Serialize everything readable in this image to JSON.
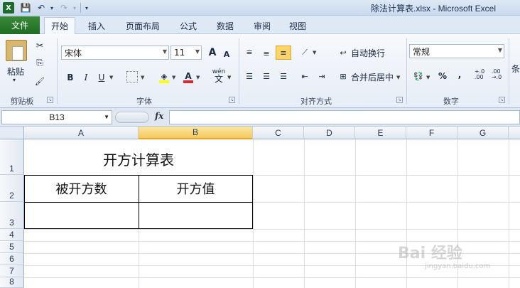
{
  "window": {
    "title": "除法计算表.xlsx  -  Microsoft Excel",
    "app_icon": "X"
  },
  "quick_access": {
    "save_icon": "💾",
    "undo_icon": "↶",
    "redo_icon": "↷",
    "drop": "▾"
  },
  "tabs": {
    "file": "文件",
    "items": [
      "开始",
      "插入",
      "页面布局",
      "公式",
      "数据",
      "审阅",
      "视图"
    ],
    "active": "开始"
  },
  "ribbon": {
    "clipboard": {
      "label": "剪贴板",
      "paste": "粘贴",
      "cut_glyph": "✂",
      "copy_glyph": "⎘",
      "brush_glyph": "🖌"
    },
    "font": {
      "label": "字体",
      "font_name": "宋体",
      "font_size": "11",
      "grow": "A",
      "shrink": "A",
      "bold": "B",
      "italic": "I",
      "underline": "U",
      "phonetic": "wén",
      "phonetic_char": "文"
    },
    "alignment": {
      "label": "对齐方式",
      "wrap": "自动换行",
      "merge": "合并后居中"
    },
    "number": {
      "label": "数字",
      "format": "常规",
      "percent": "%",
      "comma": ",",
      "inc_decimal": "+.0\n.00",
      "dec_decimal": ".00\n→.0"
    },
    "styles": {
      "partial_label": "条"
    }
  },
  "formula_bar": {
    "name_box": "B13",
    "fx": "fx",
    "value": ""
  },
  "sheet": {
    "columns": [
      "A",
      "B",
      "C",
      "D",
      "E",
      "F",
      "G"
    ],
    "selected_column": "B",
    "rows": [
      "1",
      "2",
      "3",
      "4",
      "5",
      "6",
      "7",
      "8"
    ],
    "cells": {
      "title": "开方计算表",
      "header_a": "被开方数",
      "header_b": "开方值",
      "a3": "",
      "b3": ""
    }
  },
  "watermark": {
    "text": "Bai  经验",
    "sub": "jingyan.baidu.com"
  }
}
